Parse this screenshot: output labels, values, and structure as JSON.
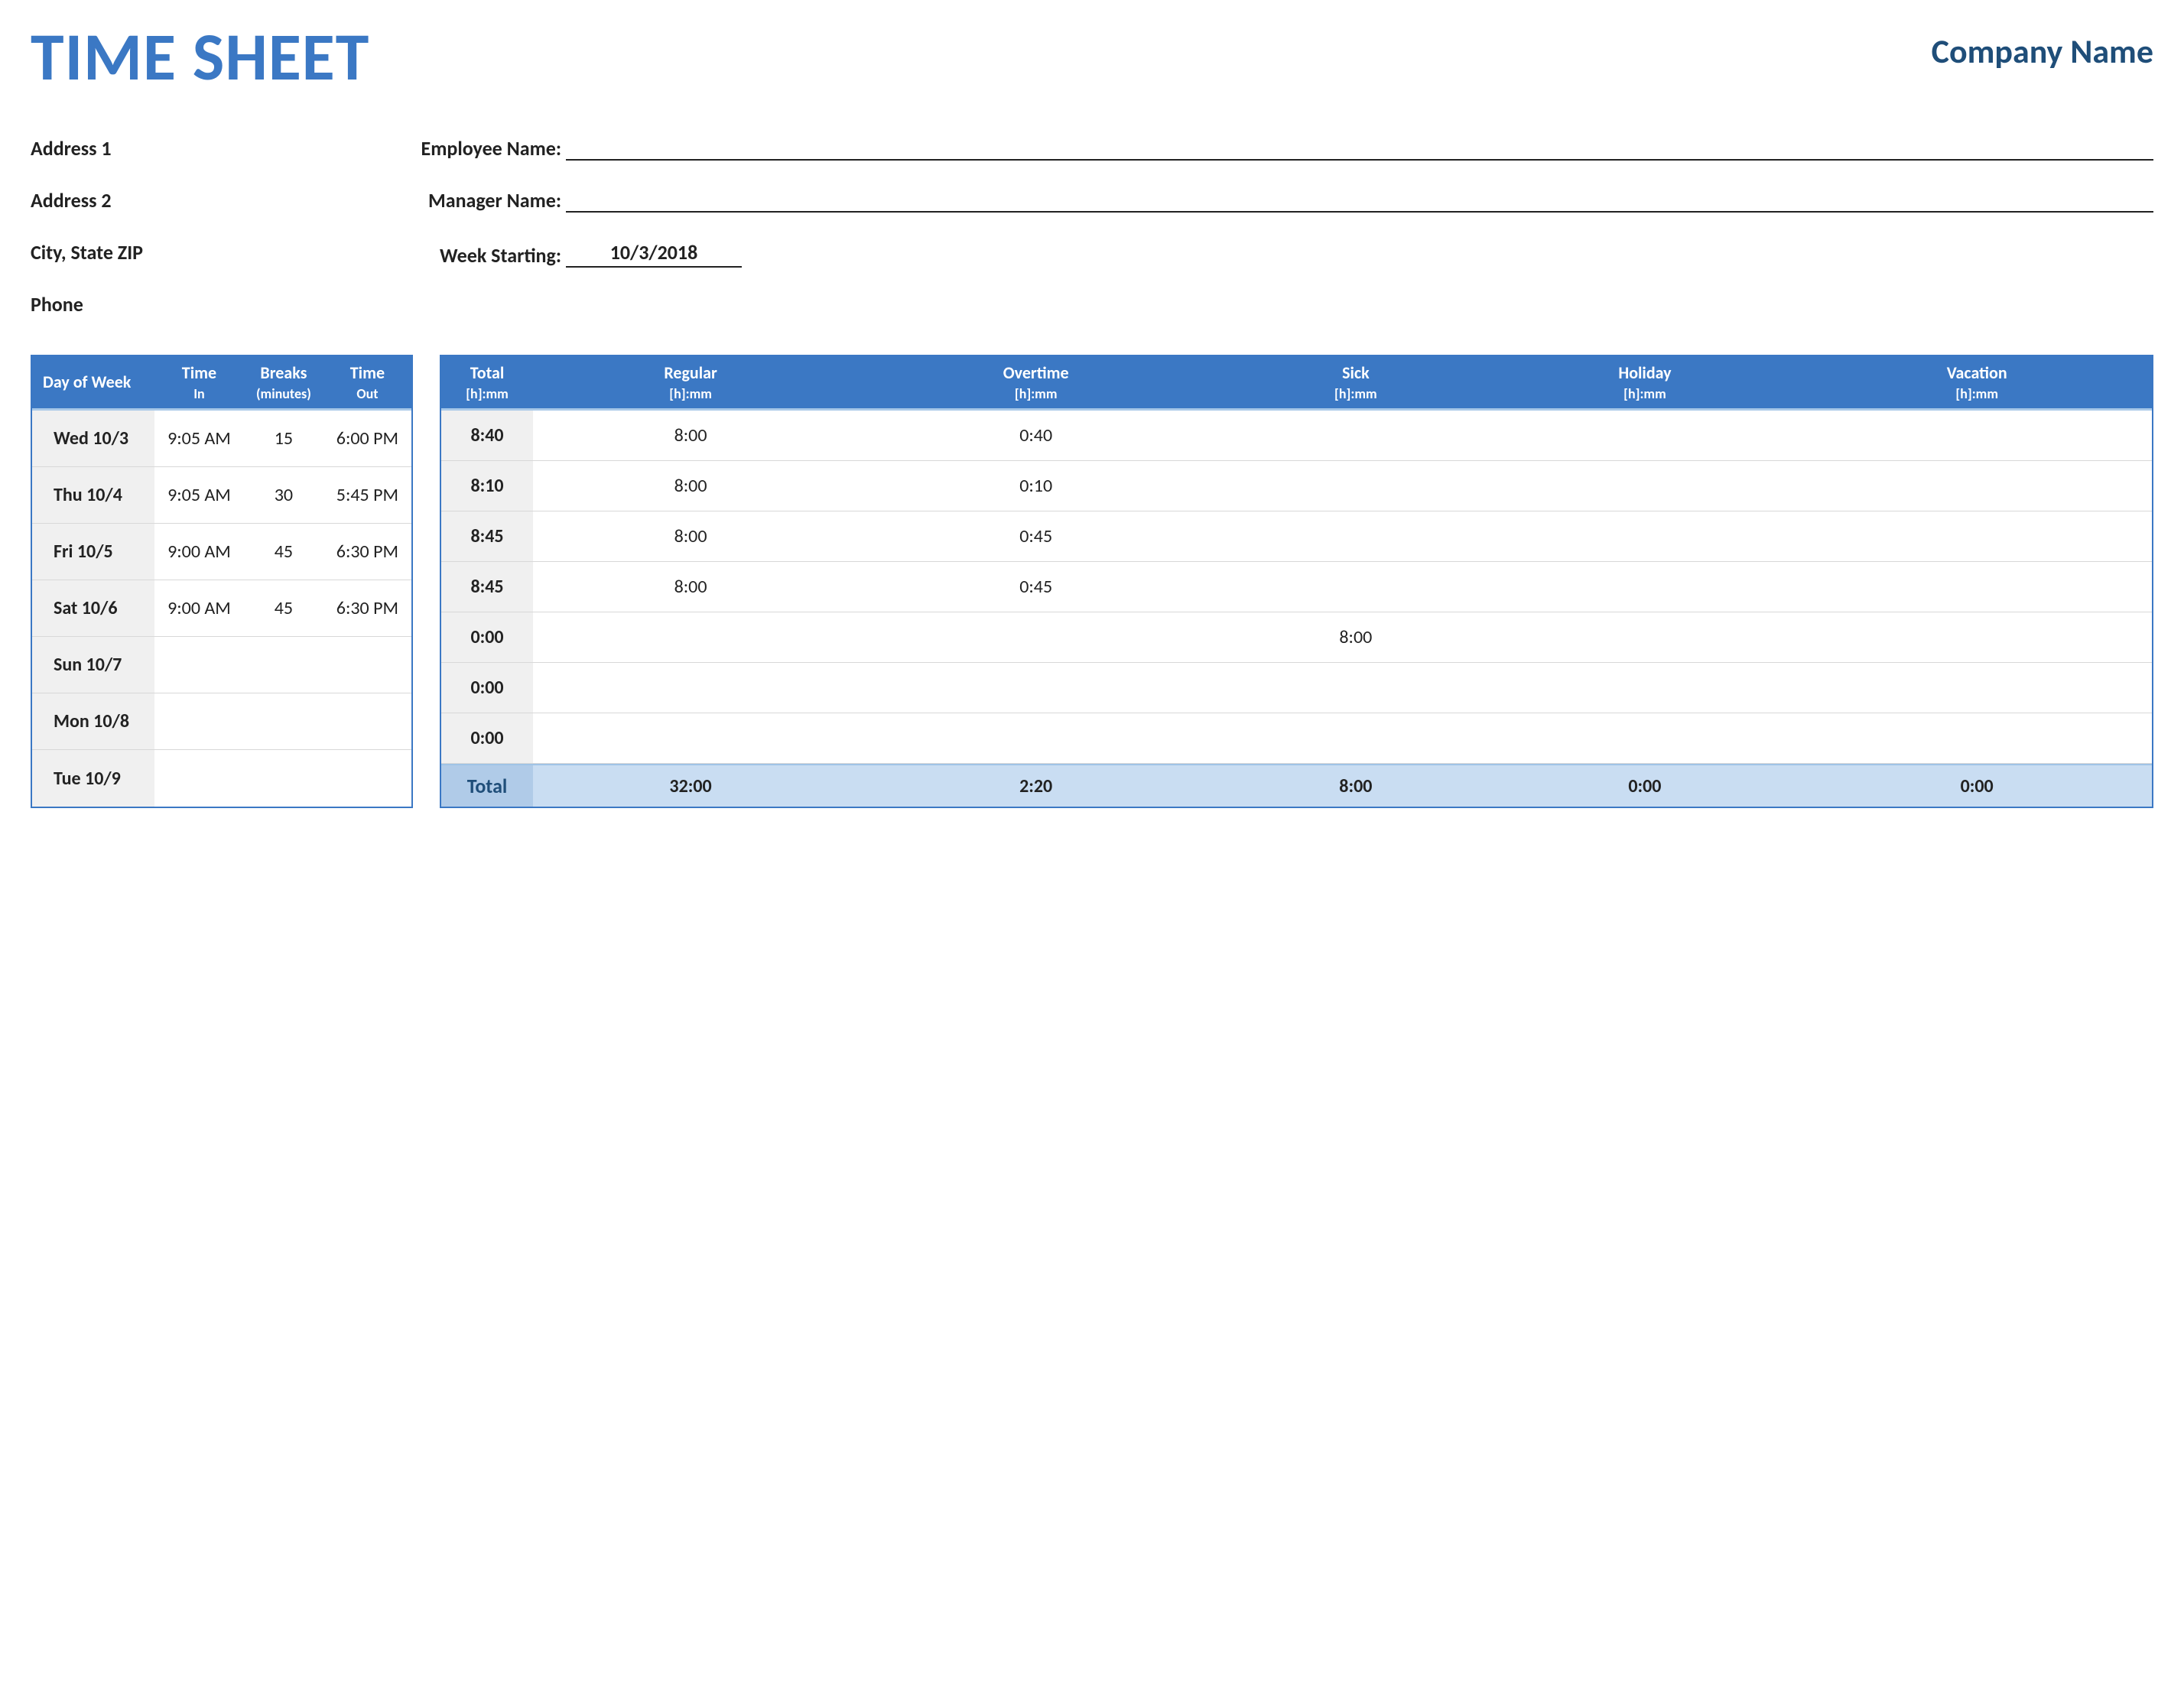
{
  "header": {
    "title": "TIME SHEET",
    "company": "Company Name"
  },
  "info": {
    "address1": "Address 1",
    "address2": "Address 2",
    "citystate": "City, State  ZIP",
    "phone": "Phone",
    "employee_label": "Employee Name:",
    "manager_label": "Manager Name:",
    "week_label": "Week Starting:",
    "employee_value": "",
    "manager_value": "",
    "week_value": "10/3/2018"
  },
  "left_headers": {
    "dow": "Day of Week",
    "time_in": "Time",
    "time_in_sub": "In",
    "breaks": "Breaks",
    "breaks_sub": "(minutes)",
    "time_out": "Time",
    "time_out_sub": "Out"
  },
  "right_headers": {
    "total": "Total",
    "regular": "Regular",
    "overtime": "Overtime",
    "sick": "Sick",
    "holiday": "Holiday",
    "vacation": "Vacation",
    "sub": "[h]:mm"
  },
  "rows": [
    {
      "dow": "Wed 10/3",
      "in": "9:05 AM",
      "breaks": "15",
      "out": "6:00 PM",
      "total": "8:40",
      "regular": "8:00",
      "overtime": "0:40",
      "sick": "",
      "holiday": "",
      "vacation": ""
    },
    {
      "dow": "Thu 10/4",
      "in": "9:05 AM",
      "breaks": "30",
      "out": "5:45 PM",
      "total": "8:10",
      "regular": "8:00",
      "overtime": "0:10",
      "sick": "",
      "holiday": "",
      "vacation": ""
    },
    {
      "dow": "Fri 10/5",
      "in": "9:00 AM",
      "breaks": "45",
      "out": "6:30 PM",
      "total": "8:45",
      "regular": "8:00",
      "overtime": "0:45",
      "sick": "",
      "holiday": "",
      "vacation": ""
    },
    {
      "dow": "Sat 10/6",
      "in": "9:00 AM",
      "breaks": "45",
      "out": "6:30 PM",
      "total": "8:45",
      "regular": "8:00",
      "overtime": "0:45",
      "sick": "",
      "holiday": "",
      "vacation": ""
    },
    {
      "dow": "Sun 10/7",
      "in": "",
      "breaks": "",
      "out": "",
      "total": "0:00",
      "regular": "",
      "overtime": "",
      "sick": "8:00",
      "holiday": "",
      "vacation": ""
    },
    {
      "dow": "Mon 10/8",
      "in": "",
      "breaks": "",
      "out": "",
      "total": "0:00",
      "regular": "",
      "overtime": "",
      "sick": "",
      "holiday": "",
      "vacation": ""
    },
    {
      "dow": "Tue 10/9",
      "in": "",
      "breaks": "",
      "out": "",
      "total": "0:00",
      "regular": "",
      "overtime": "",
      "sick": "",
      "holiday": "",
      "vacation": ""
    }
  ],
  "totals": {
    "label": "Total",
    "regular": "32:00",
    "overtime": "2:20",
    "sick": "8:00",
    "holiday": "0:00",
    "vacation": "0:00"
  }
}
